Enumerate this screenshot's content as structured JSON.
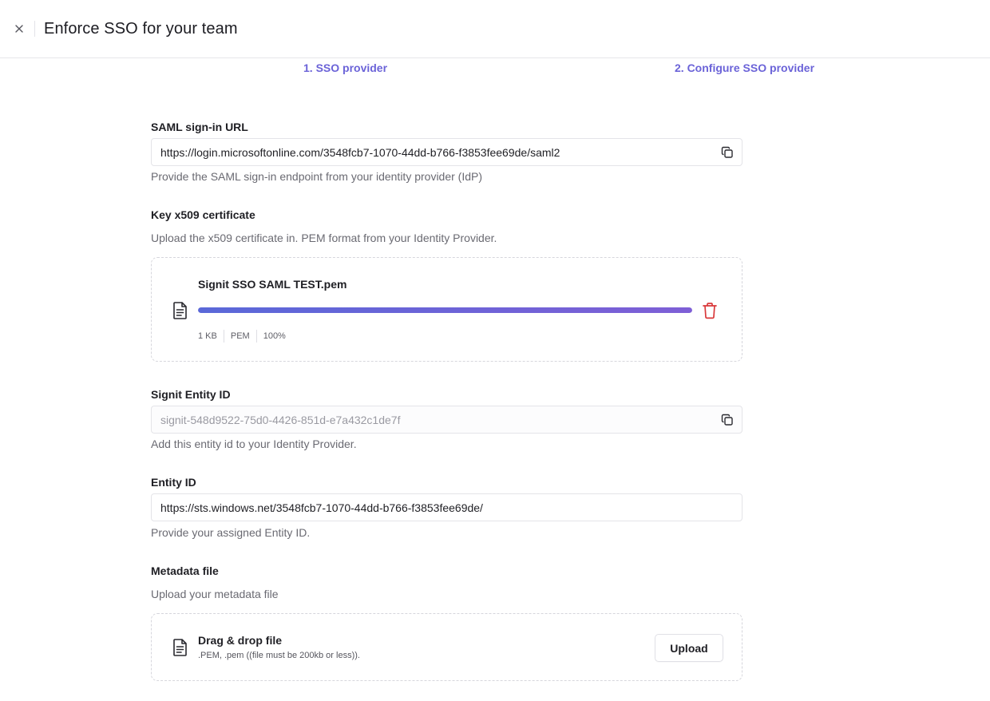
{
  "header": {
    "title": "Enforce SSO for your team",
    "close_icon": "close-icon"
  },
  "steps": [
    {
      "label": "1. SSO provider"
    },
    {
      "label": "2. Configure SSO provider"
    }
  ],
  "accent_color": "#6b63d8",
  "danger_color": "#d9383a",
  "form": {
    "saml_url": {
      "label": "SAML sign-in URL",
      "value": "https://login.microsoftonline.com/3548fcb7-1070-44dd-b766-f3853fee69de/saml2",
      "help": "Provide the SAML sign-in endpoint from your identity provider (IdP)",
      "icon": "copy-icon"
    },
    "certificate": {
      "label": "Key x509 certificate",
      "help": "Upload the x509 certificate in. PEM format from your Identity Provider.",
      "file": {
        "name": "Signit SSO SAML TEST.pem",
        "size": "1 KB",
        "type": "PEM",
        "progress_text": "100%",
        "progress": 1.0,
        "icon": "document-icon",
        "delete_icon": "trash-icon"
      }
    },
    "signit_entity_id": {
      "label": "Signit Entity ID",
      "value": "signit-548d9522-75d0-4426-851d-e7a432c1de7f",
      "help": "Add this entity id to your Identity Provider.",
      "icon": "copy-icon"
    },
    "entity_id": {
      "label": "Entity ID",
      "value": "https://sts.windows.net/3548fcb7-1070-44dd-b766-f3853fee69de/",
      "help": "Provide your assigned Entity ID."
    },
    "metadata": {
      "label": "Metadata file",
      "help": "Upload your metadata file",
      "dropzone_title": "Drag & drop file",
      "dropzone_hint": ".PEM, .pem ((file must be 200kb or less)).",
      "upload_label": "Upload",
      "icon": "document-icon"
    }
  }
}
